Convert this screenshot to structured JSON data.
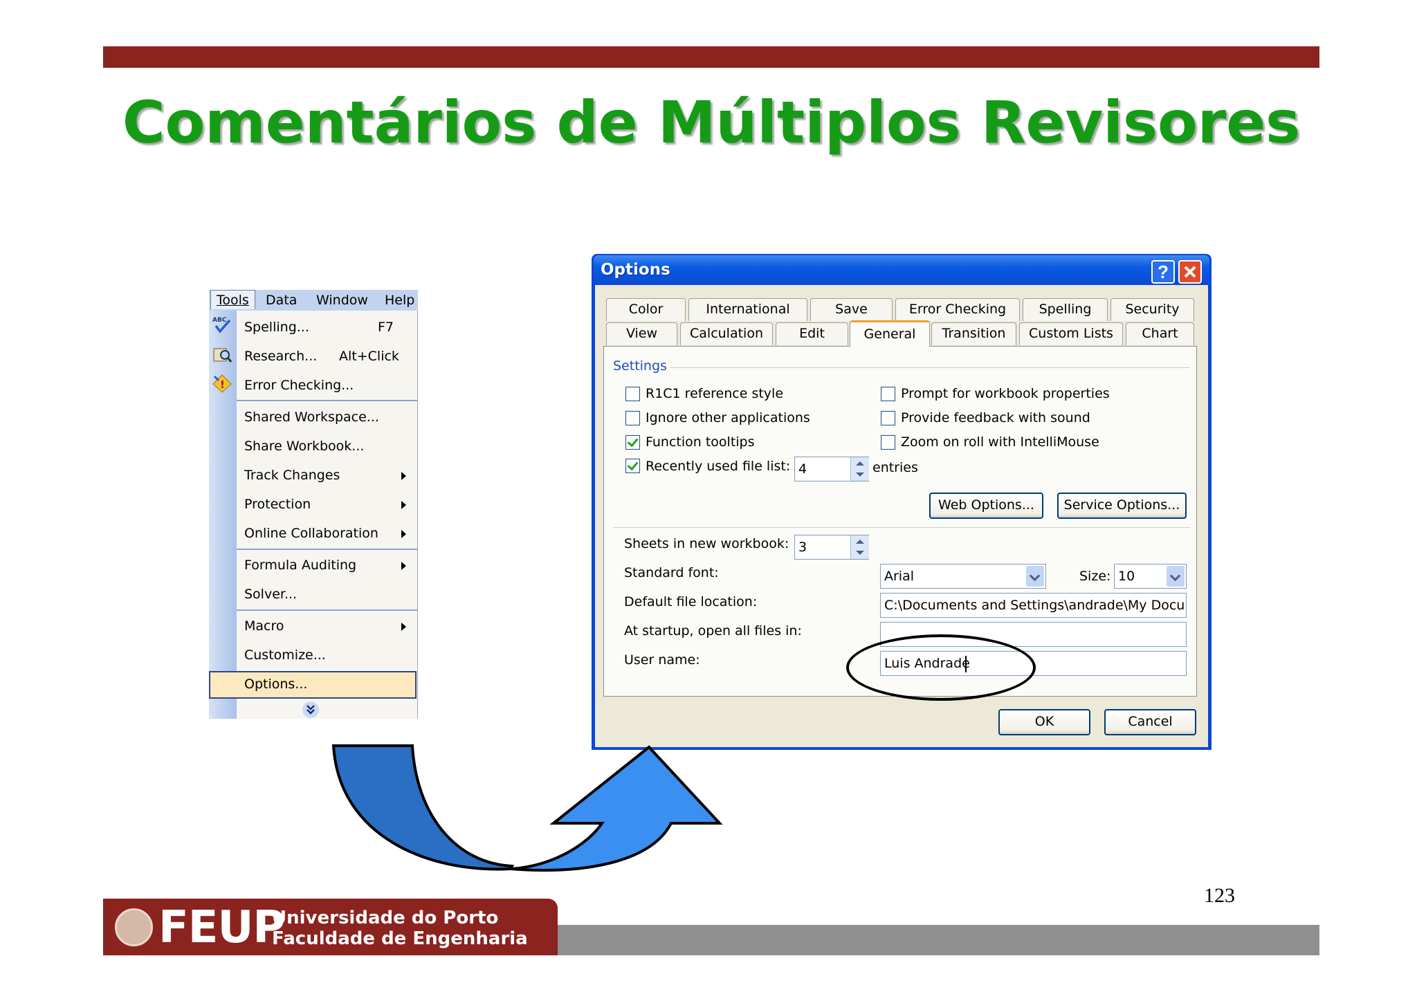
{
  "slide": {
    "title": "Comentários de Múltiplos Revisores",
    "page_number": "123"
  },
  "footer": {
    "logo_text": "FEUP",
    "university": "Universidade do Porto",
    "faculty": "Faculdade de Engenharia"
  },
  "menubar": {
    "items": [
      "Tools",
      "Data",
      "Window",
      "Help"
    ]
  },
  "tools_menu": {
    "items": [
      {
        "label": "Spelling...",
        "shortcut": "F7",
        "icon": "spelling-abc-icon"
      },
      {
        "label": "Research...",
        "shortcut": "Alt+Click",
        "icon": "research-icon"
      },
      {
        "label": "Error Checking...",
        "icon": "error-checking-icon"
      },
      {
        "label": "Shared Workspace..."
      },
      {
        "label": "Share Workbook..."
      },
      {
        "label": "Track Changes",
        "submenu": true
      },
      {
        "label": "Protection",
        "submenu": true
      },
      {
        "label": "Online Collaboration",
        "submenu": true
      },
      {
        "label": "Formula Auditing",
        "submenu": true
      },
      {
        "label": "Solver..."
      },
      {
        "label": "Macro",
        "submenu": true
      },
      {
        "label": "Customize..."
      },
      {
        "label": "Options...",
        "highlighted": true
      }
    ]
  },
  "options_dialog": {
    "title": "Options",
    "tabs_row1": [
      "Color",
      "International",
      "Save",
      "Error Checking",
      "Spelling",
      "Security"
    ],
    "tabs_row2": [
      "View",
      "Calculation",
      "Edit",
      "General",
      "Transition",
      "Custom Lists",
      "Chart"
    ],
    "active_tab": "General",
    "settings_label": "Settings",
    "checkboxes_left": [
      {
        "label": "R1C1 reference style",
        "checked": false
      },
      {
        "label": "Ignore other applications",
        "checked": false
      },
      {
        "label": "Function tooltips",
        "checked": true
      },
      {
        "label": "Recently used file list:",
        "checked": true
      }
    ],
    "checkboxes_right": [
      {
        "label": "Prompt for workbook properties",
        "checked": false
      },
      {
        "label": "Provide feedback with sound",
        "checked": false
      },
      {
        "label": "Zoom on roll with IntelliMouse",
        "checked": false
      }
    ],
    "recent_files_value": "4",
    "entries_label": "entries",
    "web_options_button": "Web Options...",
    "service_options_button": "Service Options...",
    "sheets_label": "Sheets in new workbook:",
    "sheets_value": "3",
    "standard_font_label": "Standard font:",
    "standard_font_value": "Arial",
    "size_label": "Size:",
    "size_value": "10",
    "default_location_label": "Default file location:",
    "default_location_value": "C:\\Documents and Settings\\andrade\\My Documen",
    "startup_label": "At startup, open all files in:",
    "startup_value": "",
    "user_name_label": "User name:",
    "user_name_value": "Luis Andrade",
    "ok_button": "OK",
    "cancel_button": "Cancel"
  },
  "colors": {
    "title_green": "#169b16",
    "brand_red": "#8b231f",
    "arrow_blue": "#2f7fd6"
  }
}
